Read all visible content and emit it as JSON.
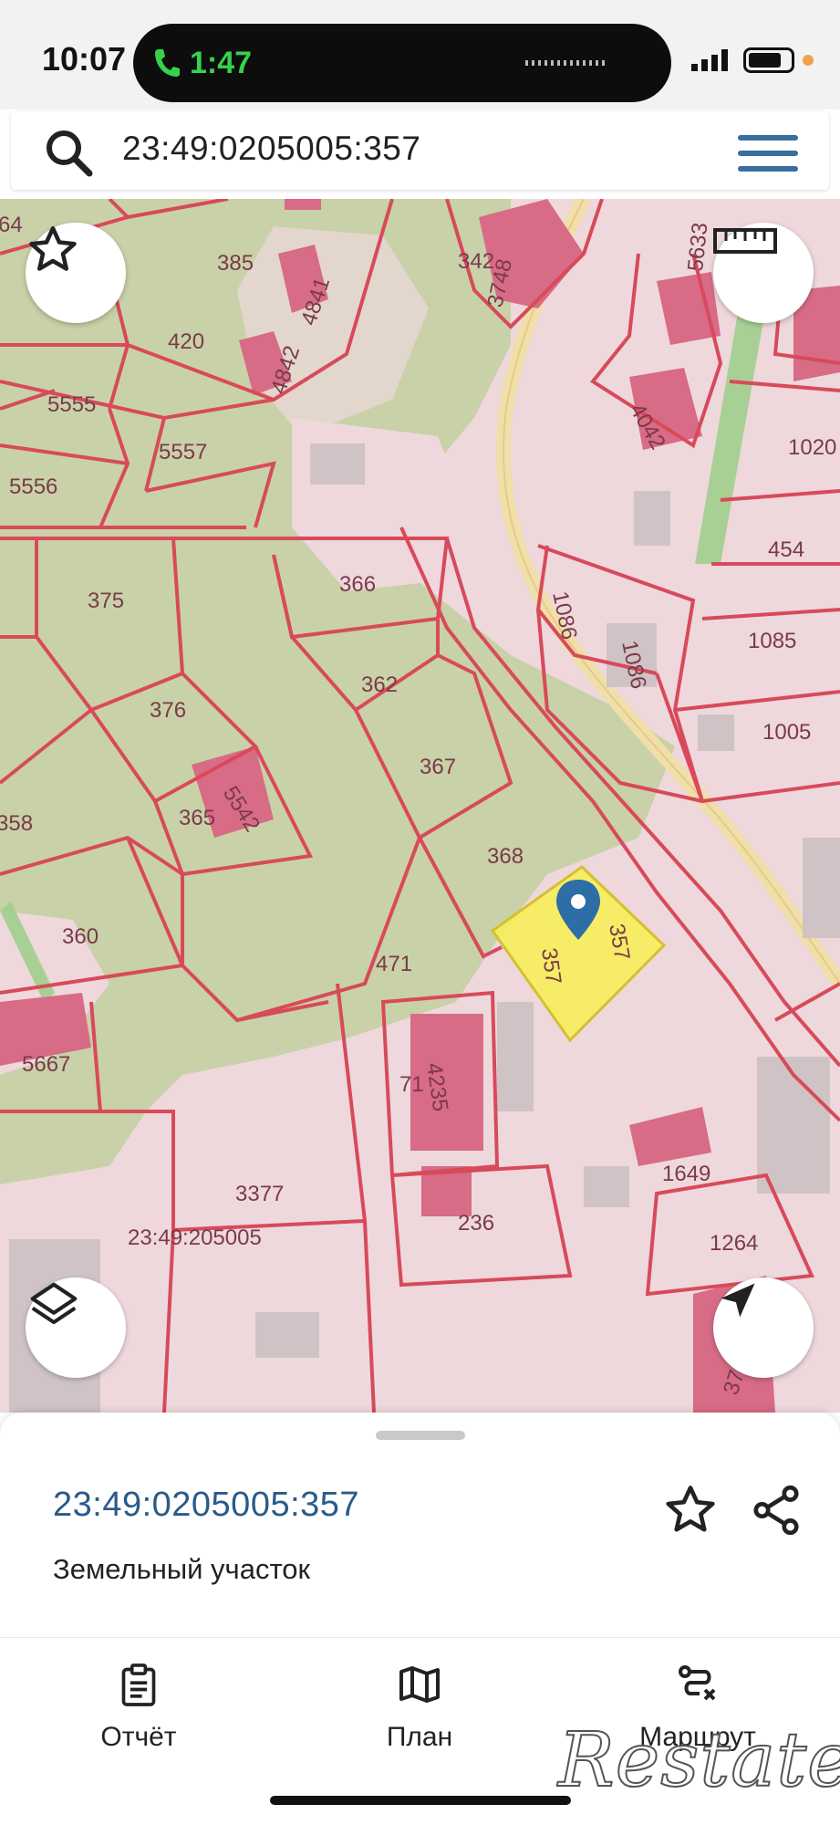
{
  "status_bar": {
    "time": "10:07",
    "call_duration": "1:47"
  },
  "search": {
    "query": "23:49:0205005:357"
  },
  "map": {
    "block_label": "23:49:205005",
    "selected_parcel": "357",
    "parcels": [
      "64",
      "385",
      "4841",
      "420",
      "4842",
      "5555",
      "5557",
      "5556",
      "342",
      "3748",
      "5633",
      "4042",
      "1020",
      "454",
      "1086",
      "1085",
      "1005",
      "366",
      "362",
      "375",
      "376",
      "365",
      "5542",
      "367",
      "368",
      "358",
      "360",
      "471",
      "5667",
      "71",
      "4235",
      "3377",
      "236",
      "1649",
      "1264",
      "37"
    ],
    "colors": {
      "background": "#eed8dc",
      "forest": "#c9d1a8",
      "building": "#d86b86",
      "border": "#d84a5a",
      "road": "#f0dfa9",
      "selected": "#f6ee5a"
    }
  },
  "sheet": {
    "cadastral_number": "23:49:0205005:357",
    "type": "Земельный участок"
  },
  "tabs": [
    {
      "label": "Отчёт",
      "icon": "clipboard-icon"
    },
    {
      "label": "План",
      "icon": "map-icon"
    },
    {
      "label": "Маршрут",
      "icon": "route-icon"
    }
  ],
  "watermark": "Restate"
}
